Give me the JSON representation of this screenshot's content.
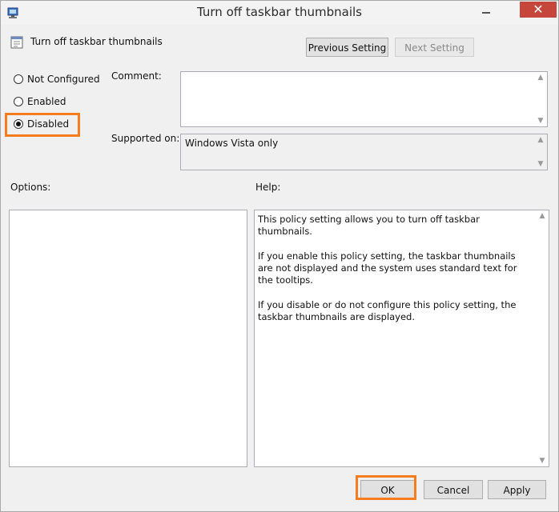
{
  "window": {
    "title": "Turn off taskbar thumbnails",
    "close_symbol": "✕"
  },
  "header": {
    "policy_name": "Turn off taskbar thumbnails",
    "previous_label": "Previous Setting",
    "next_label": "Next Setting"
  },
  "state": {
    "options": [
      {
        "label": "Not Configured",
        "checked": false
      },
      {
        "label": "Enabled",
        "checked": false
      },
      {
        "label": "Disabled",
        "checked": true
      }
    ]
  },
  "comment": {
    "label": "Comment:",
    "value": ""
  },
  "supported": {
    "label": "Supported on:",
    "value": "Windows Vista only"
  },
  "options_label": "Options:",
  "help": {
    "label": "Help:",
    "paragraphs": [
      "This policy setting allows you to turn off taskbar thumbnails.",
      "If you enable this policy setting, the taskbar thumbnails are not displayed and the system uses standard text for the tooltips.",
      "If you disable or do not configure this policy setting, the taskbar thumbnails are displayed."
    ]
  },
  "footer": {
    "ok_label": "OK",
    "cancel_label": "Cancel",
    "apply_label": "Apply"
  },
  "colors": {
    "highlight": "#f57c1f",
    "close_button": "#c7463b"
  },
  "icons": {
    "app": "policy-editor-icon",
    "policy": "policy-setting-icon"
  }
}
